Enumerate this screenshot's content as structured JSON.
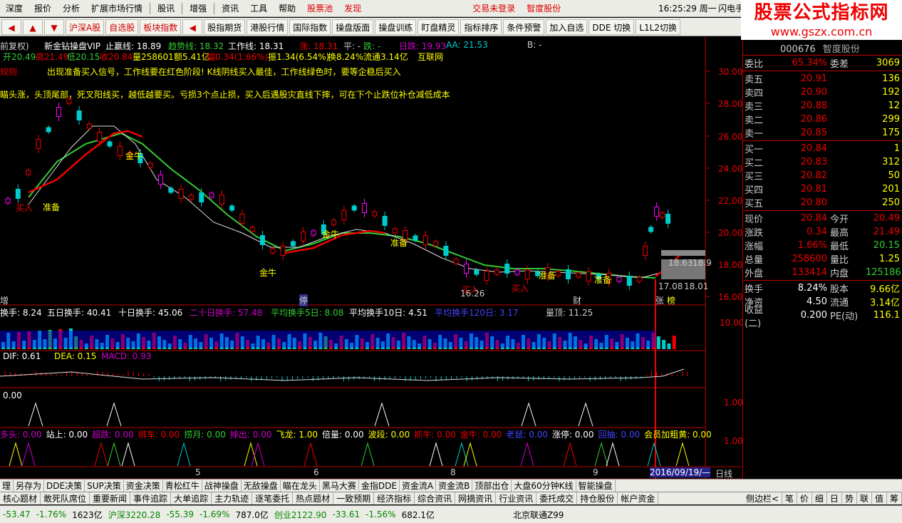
{
  "menu": [
    "深度",
    "报价",
    "分析",
    "扩展市场行情",
    "股讯",
    "增强",
    "资讯",
    "工具",
    "帮助",
    "股票池",
    "发现"
  ],
  "menu_warn": "交易未登录",
  "menu_stock": "智度股份",
  "clock": "16:25:29 周一",
  "menu_flash": "闪电手",
  "toolbar": [
    "沪深A股",
    "自选股",
    "板块指数",
    "股指期货",
    "港股行情",
    "国际指数",
    "操盘版面",
    "操盘训练",
    "盯盘精灵",
    "指标排序",
    "条件预警",
    "加入自选",
    "DDE 切换",
    "L1L2切换"
  ],
  "logo": {
    "line1": "股票公式指标网",
    "line2": "www.gszx.com.cn"
  },
  "head": {
    "restore": "前复权)",
    "title": "新金钻操盘VIP",
    "stop": "止赢线: 18.89",
    "trend": "趋势线: 18.32",
    "work": "工作线: 18.31",
    "zhang": "涨: 18.31",
    "ping": "平: -",
    "die": "跌: -",
    "ri": "日跌: 19.93",
    "aa": "AA: 21.53",
    "b": "B: -"
  },
  "ohlc": {
    "open": "开20.49",
    "high": "高21.49",
    "low": "低20.15",
    "close": "收20.84",
    "vol": "量258601",
    "amt": "额5.41亿",
    "chg": "幅0.34(1.66%)",
    "amp": "振1.34(6.54%)",
    "turn": "换8.24%",
    "flow": "流通3.14亿",
    "ind": "互联网"
  },
  "note1": "规则",
  "note2": "出现准备买入信号，工作线要在红色阶段! K线阴线买入最佳，工作线绿色时，要等企稳后买入",
  "note3": "瞄头涨，头顶尾部，死叉阳线买，越低越要买。亏损3个点止损，买入后遇股灾直线下摔，可在下个止跌位补仓减低成本",
  "price_axis": [
    "30.00",
    "28.00",
    "26.00",
    "24.00",
    "22.00",
    "20.00",
    "18.00",
    "16.00"
  ],
  "chart_labels": {
    "buy1": "买入",
    "prep": "准备",
    "jn1": "金牛",
    "jn2": "金牛",
    "jn3": "金牛",
    "buy2": "买入",
    "buy3": "买入",
    "prep2": "准备",
    "prep3": "准备",
    "prep4": "准备",
    "low": "16.26",
    "lvl1": "18.63",
    "lvl2": "18.9",
    "lvl3": "17.08",
    "lvl4": "18.01",
    "ting": "停",
    "cai": "财",
    "zeng": "增",
    "zhang": "张",
    "pang": "榜"
  },
  "turnover": {
    "t1": "换手: 8.24",
    "t5": "五日换手: 40.41",
    "t10": "十日换手: 45.06",
    "t20": "二十日换手: 57.48",
    "avg5": "平均换手5日: 8.08",
    "avg10": "平均换手10日: 4.51",
    "avg120": "平均换手120日: 3.17",
    "vol": "量顶: 11.25",
    "axis": "10.00"
  },
  "macd": {
    "dif": "DIF: 0.61",
    "dea": "DEA: 0.15",
    "macd": "MACD: 0.93"
  },
  "p4": {
    "label": "0.00",
    "axis": "1.00"
  },
  "p5": {
    "labels": [
      "多头: 0.00",
      "站上: 0.00",
      "超跌: 0.00",
      "绑车: 0.00",
      "捞月: 0.00",
      "掉出: 0.00",
      "飞龙: 1.00",
      "倍量: 0.00",
      "波段: 0.00",
      "抓牛: 0.00",
      "金牛: 0.00",
      "老鼠: 0.00",
      "涨停: 0.00",
      "回抽: 0.00",
      "会员加粗黄: 0.00"
    ],
    "axis": "1.00"
  },
  "months": [
    "5",
    "6",
    "8",
    "9"
  ],
  "date": "2016/09/19/—",
  "period": "日线",
  "right": {
    "code": "000676",
    "name": "智度股份",
    "wb": "委比",
    "wb_v": "65.34%",
    "wc": "委差",
    "wc_v": "3069",
    "sell": [
      [
        "卖五",
        "20.91",
        "136"
      ],
      [
        "卖四",
        "20.90",
        "192"
      ],
      [
        "卖三",
        "20.88",
        "12"
      ],
      [
        "卖二",
        "20.86",
        "299"
      ],
      [
        "卖一",
        "20.85",
        "175"
      ]
    ],
    "buy": [
      [
        "买一",
        "20.84",
        "1"
      ],
      [
        "买二",
        "20.83",
        "312"
      ],
      [
        "买三",
        "20.82",
        "50"
      ],
      [
        "买四",
        "20.81",
        "201"
      ],
      [
        "买五",
        "20.80",
        "250"
      ]
    ],
    "info": [
      [
        "现价",
        "20.84",
        "今开",
        "20.49"
      ],
      [
        "涨跌",
        "0.34",
        "最高",
        "21.49"
      ],
      [
        "涨幅",
        "1.66%",
        "最低",
        "20.15"
      ],
      [
        "总量",
        "258600",
        "量比",
        "1.25"
      ],
      [
        "外盘",
        "133414",
        "内盘",
        "125186"
      ]
    ],
    "info2": [
      [
        "换手",
        "8.24%",
        "股本",
        "9.66亿"
      ],
      [
        "净资",
        "4.50",
        "流通",
        "3.14亿"
      ],
      [
        "收益(二)",
        "0.200",
        "PE(动)",
        "116.1"
      ]
    ]
  },
  "bottom1": [
    "理",
    "另存为",
    "DDE决策",
    "SUP决策",
    "资金决策",
    "青松红牛",
    "战神操盘",
    "无敌操盘",
    "瞄在龙头",
    "黑马大赛",
    "金指DDE",
    "资金流A",
    "资金流B",
    "顶部出仓",
    "大盘60分钟K线",
    "智能操盘"
  ],
  "bottom2": [
    "核心题材",
    "敢死队席位",
    "重要新闻",
    "事件追踪",
    "大单追踪",
    "主力轨迹",
    "逐笔委托",
    "热点题材",
    "一致预期",
    "经济指标",
    "综合资讯",
    "网摘资讯",
    "行业资讯",
    "委托成交",
    "持仓股份",
    "帐户资金"
  ],
  "side": [
    "侧边栏<",
    "笔",
    "价",
    "细",
    "日",
    "势",
    "联",
    "值",
    "筹"
  ],
  "status": {
    "s1": "-53.47",
    "s2": "-1.76%",
    "s3": "1623亿",
    "sz": "沪深3220.28",
    "s4": "-55.39",
    "s5": "-1.69%",
    "s6": "787.0亿",
    "cy": "创业2122.90",
    "s7": "-33.61",
    "s8": "-1.56%",
    "s9": "682.1亿",
    "net": "北京联通Z99"
  }
}
